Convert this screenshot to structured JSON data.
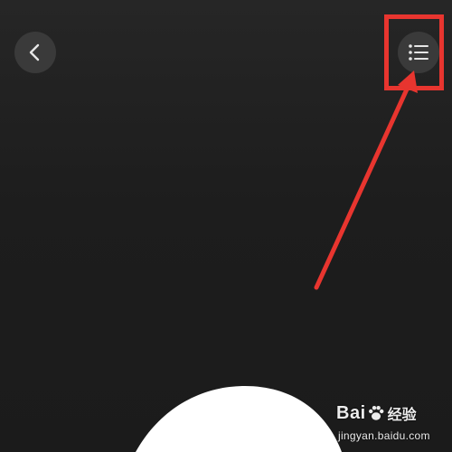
{
  "toolbar": {
    "back_icon": "chevron-left-icon",
    "menu_icon": "list-menu-icon"
  },
  "annotation": {
    "highlight_color": "#e8352f",
    "arrow_color": "#e8352f"
  },
  "watermark": {
    "brand_left": "Bai",
    "brand_right": "经验",
    "url": "jingyan.baidu.com"
  },
  "colors": {
    "background": "#1f1f1f",
    "button_bg": "#3a3a3a",
    "icon": "#e6e6e6",
    "blob": "#ffffff"
  }
}
